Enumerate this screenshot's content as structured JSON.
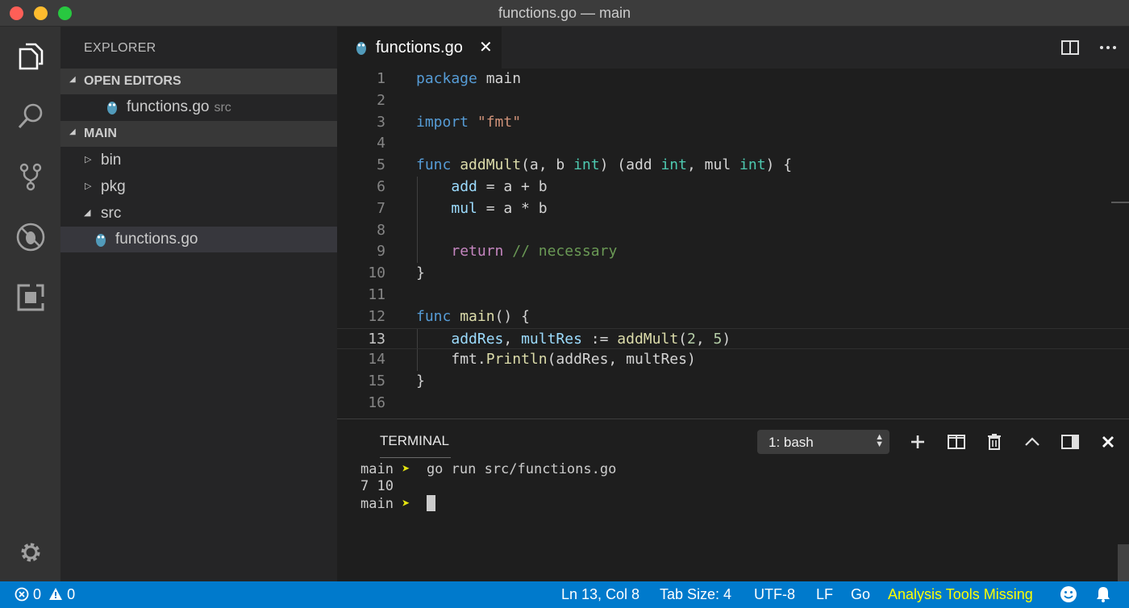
{
  "window": {
    "title": "functions.go — main"
  },
  "activity_bar": {
    "items": [
      "explorer-icon",
      "search-icon",
      "source-control-icon",
      "debug-icon",
      "extensions-icon"
    ],
    "bottom": "gear-icon"
  },
  "sidebar": {
    "title": "EXPLORER",
    "open_editors": {
      "label": "OPEN EDITORS",
      "items": [
        {
          "name": "functions.go",
          "hint": "src"
        }
      ]
    },
    "folder": {
      "label": "MAIN",
      "items": [
        {
          "name": "bin",
          "expanded": false
        },
        {
          "name": "pkg",
          "expanded": false
        },
        {
          "name": "src",
          "expanded": true
        },
        {
          "name": "functions.go",
          "selected": true
        }
      ]
    }
  },
  "editor": {
    "tab": {
      "label": "functions.go",
      "close": "✕"
    },
    "current_line": 13,
    "lines": [
      {
        "n": "1"
      },
      {
        "n": "2"
      },
      {
        "n": "3"
      },
      {
        "n": "4"
      },
      {
        "n": "5"
      },
      {
        "n": "6"
      },
      {
        "n": "7"
      },
      {
        "n": "8"
      },
      {
        "n": "9"
      },
      {
        "n": "10"
      },
      {
        "n": "11"
      },
      {
        "n": "12"
      },
      {
        "n": "13"
      },
      {
        "n": "14"
      },
      {
        "n": "15"
      },
      {
        "n": "16"
      }
    ],
    "tokens": {
      "l1": {
        "kw": "package",
        "rest": " main"
      },
      "l3": {
        "kw": "import",
        "str": "\"fmt\""
      },
      "l5": {
        "kw": "func",
        "fn": "addMult",
        "p1": "(a, b ",
        "t1": "int",
        "p2": ") (add ",
        "t2": "int",
        "p3": ", mul ",
        "t3": "int",
        "p4": ") {"
      },
      "l6": {
        "var": "add",
        "rest": " = a + b"
      },
      "l7": {
        "var": "mul",
        "rest": " = a * b"
      },
      "l9": {
        "ctl": "return",
        "cmt": "// necessary"
      },
      "l10": {
        "rest": "}"
      },
      "l12": {
        "kw": "func",
        "fn": "main",
        "rest": "() {"
      },
      "l13": {
        "v1": "addRes",
        "c1": ", ",
        "v2": "multRes",
        "op": " := ",
        "fn": "addMult",
        "p1": "(",
        "n1": "2",
        "c2": ", ",
        "n2": "5",
        "p2": ")"
      },
      "l14": {
        "pkg": "fmt.",
        "fn": "Println",
        "rest": "(addRes, multRes)"
      },
      "l15": {
        "rest": "}"
      }
    }
  },
  "terminal": {
    "title": "TERMINAL",
    "selected_shell": "1: bash",
    "lines": [
      {
        "prompt": "main",
        "arrow": "➤",
        "command": "go run src/functions.go"
      },
      {
        "output": "7 10"
      },
      {
        "prompt": "main",
        "arrow": "➤",
        "command": ""
      }
    ]
  },
  "status_bar": {
    "errors": "0",
    "warnings": "0",
    "position": "Ln 13, Col 8",
    "tab_size": "Tab Size: 4",
    "encoding": "UTF-8",
    "eol": "LF",
    "language": "Go",
    "analysis": "Analysis Tools Missing"
  },
  "colors": {
    "status_bar": "#007acc",
    "activity_bar": "#333333",
    "sidebar": "#252526",
    "editor": "#1e1e1e",
    "keyword": "#569cd6",
    "function": "#dcdcaa",
    "string": "#ce9178",
    "number": "#b5cea8",
    "variable": "#9cdcfe",
    "control": "#c586c0",
    "comment": "#6a9955",
    "warning_text": "#ffff00"
  }
}
